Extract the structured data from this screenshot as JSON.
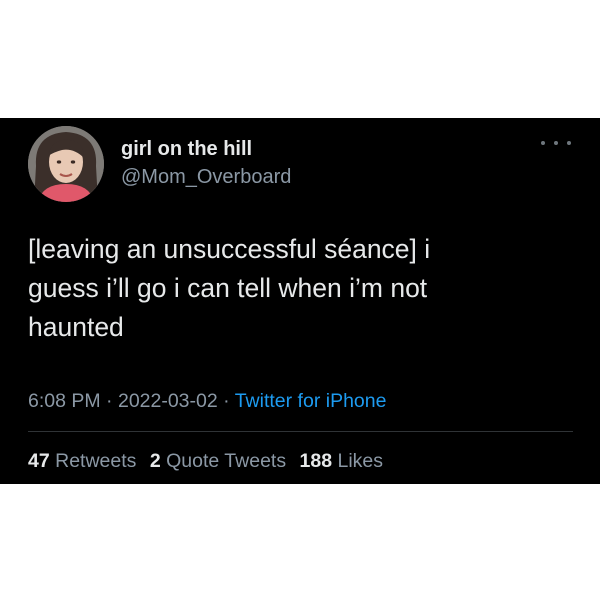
{
  "tweet": {
    "author": {
      "display_name": "girl on the hill",
      "handle": "@Mom_Overboard"
    },
    "more_icon": "more-horizontal-icon",
    "text": "[leaving an unsuccessful séance] i\nguess i’ll go i can tell when i’m not\nhaunted",
    "meta": {
      "time": "6:08 PM",
      "separator": "·",
      "date": "2022-03-02",
      "source": "Twitter for iPhone"
    },
    "stats": {
      "retweets_count": "47",
      "retweets_label": "Retweets",
      "quotes_count": "2",
      "quotes_label": "Quote Tweets",
      "likes_count": "188",
      "likes_label": "Likes"
    },
    "colors": {
      "background": "#000000",
      "primary_text": "#e7e9ea",
      "secondary_text": "#8b98a5",
      "link": "#1d9bf0",
      "divider": "#2f3336"
    }
  }
}
